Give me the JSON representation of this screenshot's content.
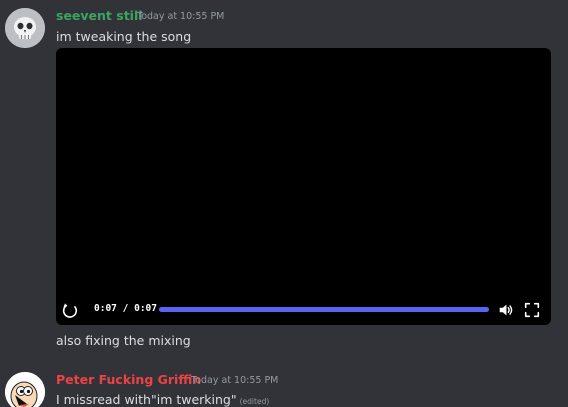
{
  "colors": {
    "background": "#313338",
    "author1": "#3ba55d",
    "author2": "#ed4245",
    "progress": "#5865f2"
  },
  "messages": [
    {
      "author": "seevent still",
      "timestamp": "Today at 10:55 PM",
      "text": "im tweaking the song",
      "attachment": {
        "type": "video",
        "current_time": "0:07",
        "duration": "0:07",
        "progress_percent": 100,
        "icons": [
          "replay-icon",
          "volume-icon",
          "fullscreen-icon"
        ]
      },
      "followup_text": "also fixing the mixing"
    },
    {
      "author": "Peter Fucking Griffin",
      "timestamp": "Today at 10:55 PM",
      "text": "I missread with\"im twerking\"",
      "edited_label": "(edited)"
    }
  ]
}
